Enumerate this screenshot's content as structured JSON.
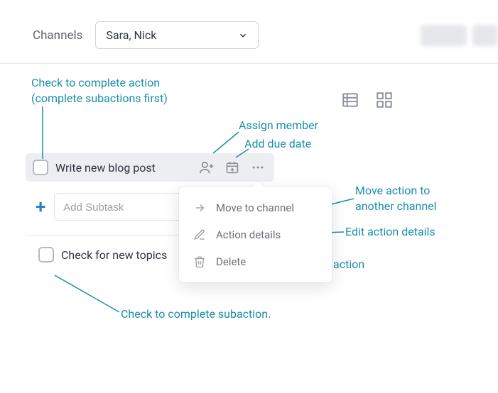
{
  "header": {
    "channels_label": "Channels",
    "dropdown_value": "Sara, Nick"
  },
  "task": {
    "main": "Write new blog post",
    "subtask_placeholder": "Add Subtask",
    "sub_item": "Check for new topics"
  },
  "menu": {
    "move": "Move to channel",
    "details": "Action details",
    "delete": "Delete"
  },
  "annotations": {
    "check_main": "Check to complete action\n(complete subactions first)",
    "assign_member": "Assign member",
    "add_due_date": "Add due date",
    "move_action": "Move action to\nanother channel",
    "edit_details": "Edit action details",
    "delete_action": "Delete action",
    "check_sub": "Check to complete subaction."
  }
}
